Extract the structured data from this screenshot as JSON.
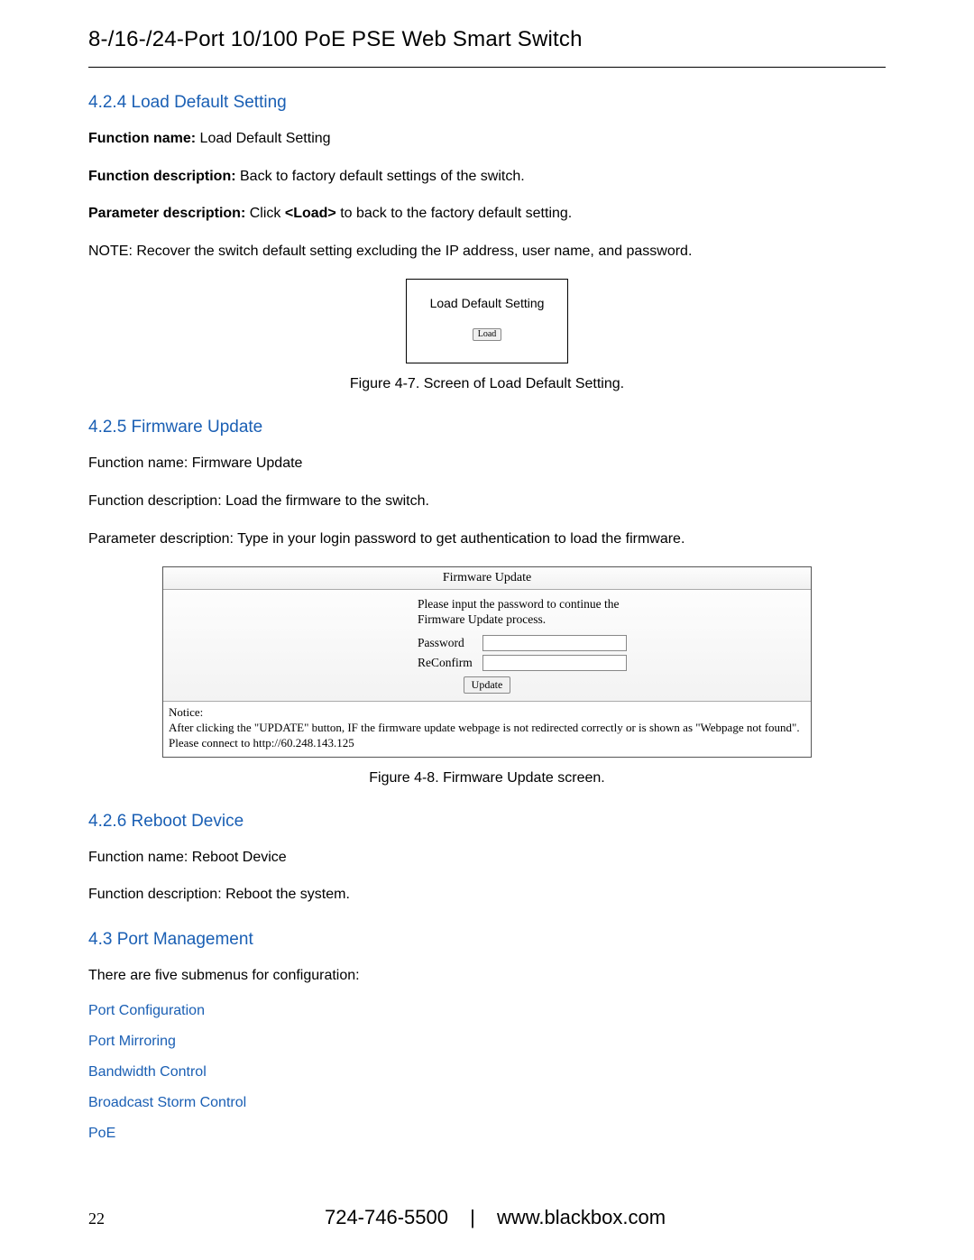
{
  "doc_title": "8-/16-/24-Port 10/100 PoE PSE Web Smart Switch",
  "s424": {
    "heading": "4.2.4 Load Default Setting",
    "p1_label": "Function name:",
    "p1_value": "  Load Default Setting",
    "p2_label": "Function description:",
    "p2_value": " Back to factory default settings of the switch.",
    "p3_label": "Parameter description:",
    "p3_value_a": " Click ",
    "p3_value_b": "<Load>",
    "p3_value_c": " to back to the factory default setting.",
    "note": "NOTE: Recover the switch default setting excluding the IP address, user name, and password.",
    "fig": {
      "title": "Load Default Setting",
      "button": "Load",
      "caption": "Figure 4-7. Screen of Load Default Setting."
    }
  },
  "s425": {
    "heading": "4.2.5 Firmware Update",
    "p1": "Function name:  Firmware Update",
    "p2": "Function description: Load the firmware to the switch.",
    "p3": "Parameter description: Type in your login password to get authentication to load the firmware.",
    "fig": {
      "head": "Firmware Update",
      "instr1": "Please input the password to continue the",
      "instr2": "Firmware Update process.",
      "pw_label": "Password",
      "rc_label": "ReConfirm",
      "update": "Update",
      "notice_head": "Notice:",
      "notice_body": "After clicking the \"UPDATE\" button, IF the firmware update webpage is not redirected correctly or is shown as \"Webpage not found\".",
      "notice_tail": "Please connect to http://60.248.143.125",
      "caption": "Figure 4-8. Firmware Update screen."
    }
  },
  "s426": {
    "heading": "4.2.6 Reboot Device",
    "p1": "Function name: Reboot Device",
    "p2": "Function description: Reboot the system."
  },
  "s43": {
    "heading": "4.3 Port Management",
    "intro": "There are five submenus for configuration:",
    "links": {
      "a": "Port Configuration",
      "b": "Port Mirroring",
      "c": "Bandwidth Control",
      "d": "Broadcast Storm Control",
      "e": "PoE"
    }
  },
  "footer": {
    "page": "22",
    "phone": "724-746-5500",
    "divider": "|",
    "url": "www.blackbox.com"
  }
}
